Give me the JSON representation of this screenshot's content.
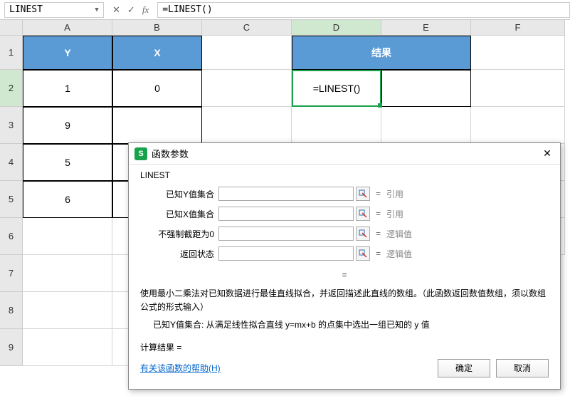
{
  "nameBox": "LINEST",
  "fx": {
    "cancel": "✕",
    "confirm": "✓",
    "label": "fx"
  },
  "formula": "=LINEST()",
  "columns": [
    "A",
    "B",
    "C",
    "D",
    "E",
    "F"
  ],
  "rows": [
    "1",
    "2",
    "3",
    "4",
    "5",
    "6",
    "7",
    "8",
    "9"
  ],
  "headers": {
    "Y": "Y",
    "X": "X",
    "result": "结果"
  },
  "dataA": [
    "1",
    "9",
    "5",
    "6"
  ],
  "dataB": [
    "0"
  ],
  "activeCell": "=LINEST()",
  "dialog": {
    "title": "函数参数",
    "fnName": "LINEST",
    "params": [
      {
        "label": "已知Y值集合",
        "hint": "引用"
      },
      {
        "label": "已知X值集合",
        "hint": "引用"
      },
      {
        "label": "不强制截距为0",
        "hint": "逻辑值"
      },
      {
        "label": "返回状态",
        "hint": "逻辑值"
      }
    ],
    "eq": "=",
    "desc": "使用最小二乘法对已知数据进行最佳直线拟合，并返回描述此直线的数组。（此函数返回数值数组，须以数组公式的形式输入）",
    "paramDescLabel": "已知Y值集合:",
    "paramDesc": "从满足线性拟合直线 y=mx+b 的点集中选出一组已知的 y 值",
    "calcResultLabel": "计算结果 =",
    "helpLink": "有关该函数的帮助(H)",
    "ok": "确定",
    "cancel": "取消"
  }
}
